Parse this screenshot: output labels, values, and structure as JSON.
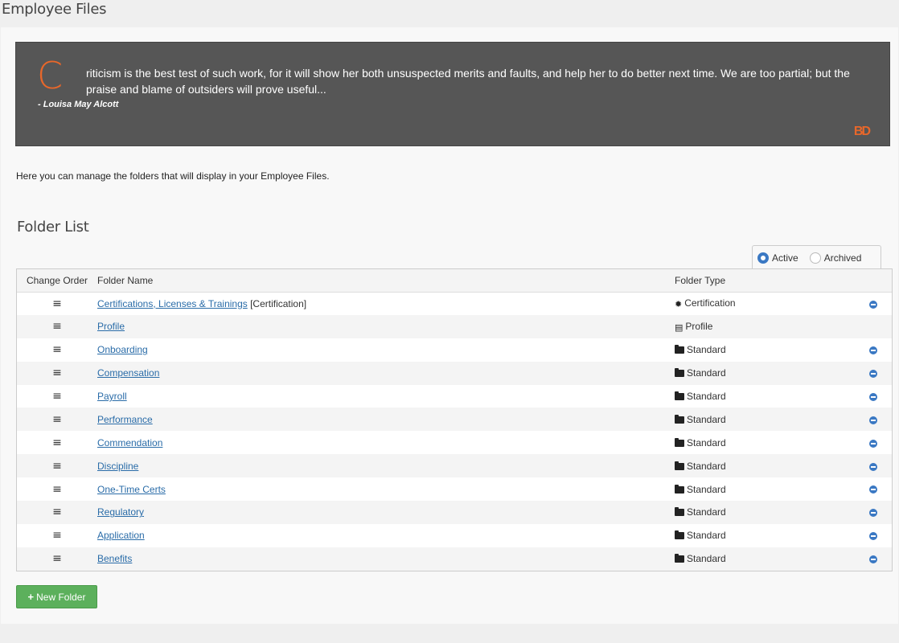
{
  "page": {
    "title": "Employee Files"
  },
  "quote": {
    "initial": "C",
    "text": "riticism is the best test of such work, for it will show her both unsuspected merits and faults, and help her to do better next time. We are too partial; but the praise and blame of outsiders will prove useful...",
    "author": "- Louisa May Alcott",
    "logo_text": "BD"
  },
  "intro": "Here you can manage the folders that will display in your Employee Files.",
  "folder_list": {
    "title": "Folder List",
    "status_options": [
      {
        "label": "Active",
        "checked": true
      },
      {
        "label": "Archived",
        "checked": false
      }
    ],
    "columns": {
      "order": "Change Order",
      "name": "Folder Name",
      "type": "Folder Type"
    },
    "rows": [
      {
        "name": "Certifications, Licenses & Trainings",
        "suffix": " [Certification]",
        "type": "Certification",
        "type_icon": "certificate-icon",
        "removable": true
      },
      {
        "name": "Profile",
        "suffix": "",
        "type": "Profile",
        "type_icon": "id-card-icon",
        "removable": false
      },
      {
        "name": "Onboarding",
        "suffix": "",
        "type": "Standard",
        "type_icon": "folder-icon",
        "removable": true
      },
      {
        "name": "Compensation",
        "suffix": "",
        "type": "Standard",
        "type_icon": "folder-icon",
        "removable": true
      },
      {
        "name": "Payroll",
        "suffix": "",
        "type": "Standard",
        "type_icon": "folder-icon",
        "removable": true
      },
      {
        "name": "Performance",
        "suffix": "",
        "type": "Standard",
        "type_icon": "folder-icon",
        "removable": true
      },
      {
        "name": "Commendation",
        "suffix": "",
        "type": "Standard",
        "type_icon": "folder-icon",
        "removable": true
      },
      {
        "name": "Discipline",
        "suffix": "",
        "type": "Standard",
        "type_icon": "folder-icon",
        "removable": true
      },
      {
        "name": "One-Time Certs",
        "suffix": "",
        "type": "Standard",
        "type_icon": "folder-icon",
        "removable": true
      },
      {
        "name": "Regulatory",
        "suffix": "",
        "type": "Standard",
        "type_icon": "folder-icon",
        "removable": true
      },
      {
        "name": "Application",
        "suffix": "",
        "type": "Standard",
        "type_icon": "folder-icon",
        "removable": true
      },
      {
        "name": "Benefits",
        "suffix": "",
        "type": "Standard",
        "type_icon": "folder-icon",
        "removable": true
      }
    ]
  },
  "actions": {
    "new_folder_label": "New Folder"
  },
  "colors": {
    "accent": "#e8672a",
    "link": "#2a6ca8",
    "primary": "#3a78c3",
    "success": "#5cb05c",
    "quote_bg": "#565656"
  }
}
